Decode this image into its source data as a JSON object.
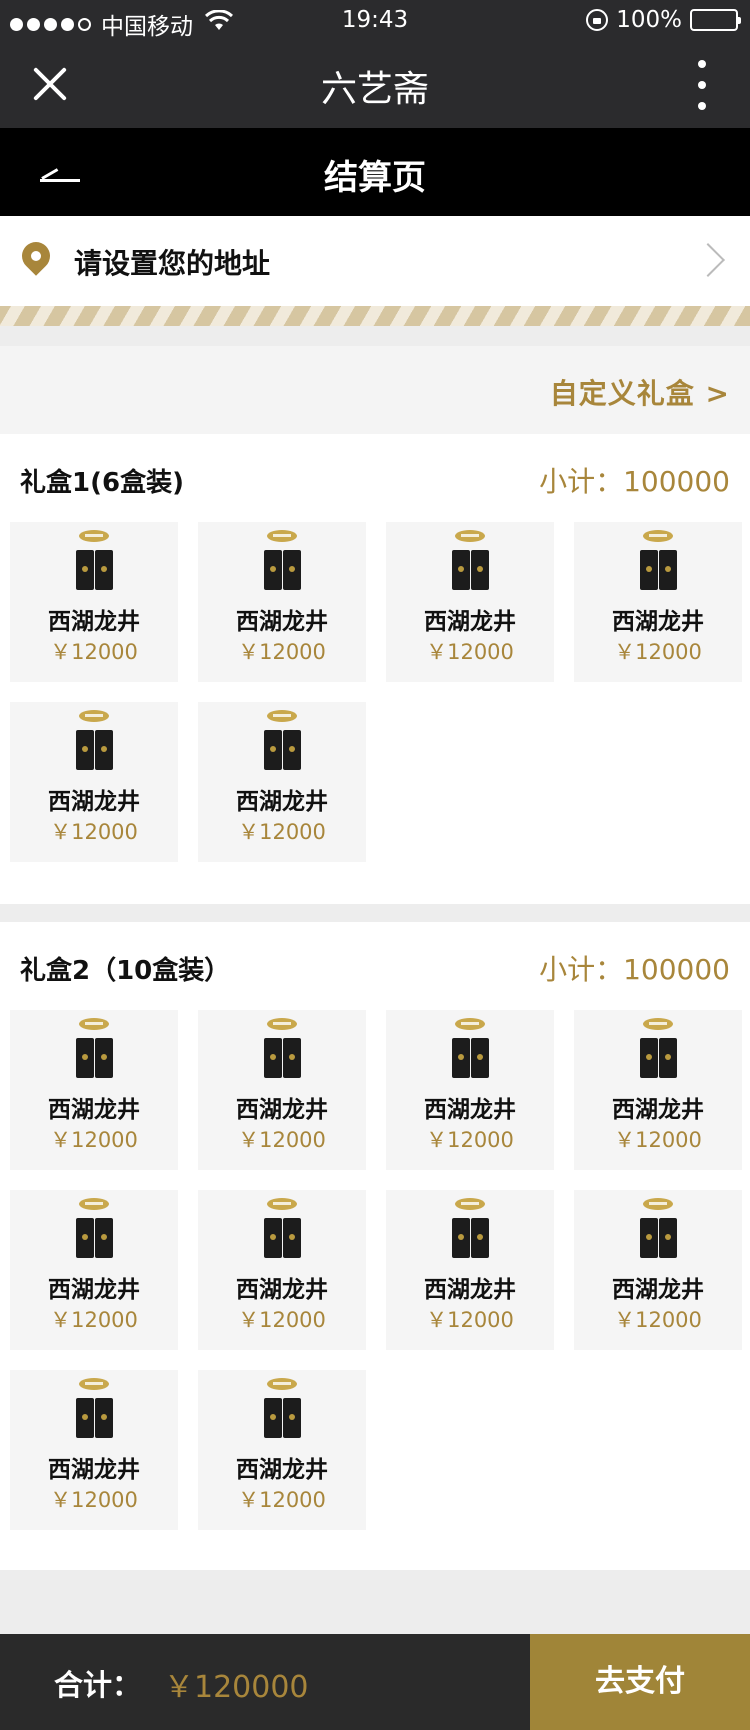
{
  "status_bar": {
    "carrier": "中国移动",
    "time": "19:43",
    "battery": "100%"
  },
  "wechat_nav": {
    "title": "六艺斋"
  },
  "page_header": {
    "title": "结算页"
  },
  "address": {
    "prompt": "请设置您的地址"
  },
  "custom_giftbox": {
    "label": "自定义礼盒 >"
  },
  "boxes": [
    {
      "name": "礼盒1(6盒装)",
      "subtotal": "小计：100000",
      "items": [
        {
          "name": "西湖龙井",
          "price": "￥12000"
        },
        {
          "name": "西湖龙井",
          "price": "￥12000"
        },
        {
          "name": "西湖龙井",
          "price": "￥12000"
        },
        {
          "name": "西湖龙井",
          "price": "￥12000"
        },
        {
          "name": "西湖龙井",
          "price": "￥12000"
        },
        {
          "name": "西湖龙井",
          "price": "￥12000"
        }
      ]
    },
    {
      "name": "礼盒2（10盒装）",
      "subtotal": "小计：100000",
      "items": [
        {
          "name": "西湖龙井",
          "price": "￥12000"
        },
        {
          "name": "西湖龙井",
          "price": "￥12000"
        },
        {
          "name": "西湖龙井",
          "price": "￥12000"
        },
        {
          "name": "西湖龙井",
          "price": "￥12000"
        },
        {
          "name": "西湖龙井",
          "price": "￥12000"
        },
        {
          "name": "西湖龙井",
          "price": "￥12000"
        },
        {
          "name": "西湖龙井",
          "price": "￥12000"
        },
        {
          "name": "西湖龙井",
          "price": "￥12000"
        },
        {
          "name": "西湖龙井",
          "price": "￥12000"
        },
        {
          "name": "西湖龙井",
          "price": "￥12000"
        }
      ]
    }
  ],
  "footer": {
    "total_label": "合计：",
    "total_value": "￥120000",
    "pay_button": "去支付"
  },
  "colors": {
    "accent": "#a8863b",
    "header_bg": "#000000",
    "nav_bg": "#2b2b2d"
  }
}
